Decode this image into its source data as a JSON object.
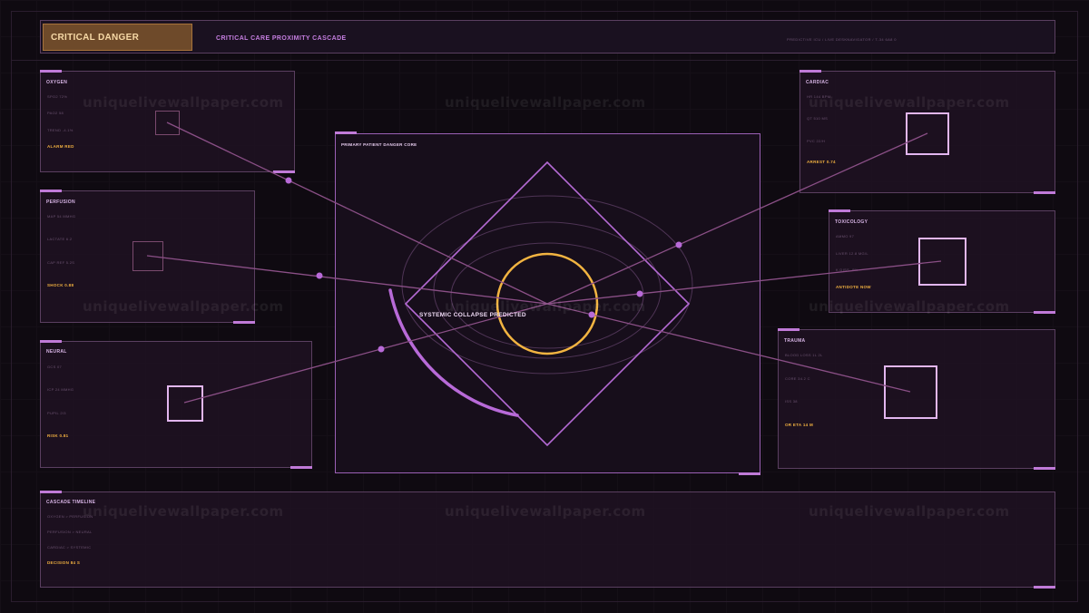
{
  "header": {
    "alert": "CRITICAL DANGER",
    "title": "CRITICAL CARE PROXIMITY CASCADE",
    "meta": "PREDICTIVE ICU  /  LIVE DESKNAVIGATOR  /  T-34 6A8 0"
  },
  "panels": {
    "oxygen": {
      "title": "OXYGEN",
      "lines": [
        "SPO2 72%",
        "PAO2 58",
        "TREND -4.1%"
      ],
      "alarm": "ALARM RED"
    },
    "perfusion": {
      "title": "PERFUSION",
      "lines": [
        "MAP 54 MMHG",
        "LACTATE 6.2",
        "CAP REF 5.2S"
      ],
      "alarm": "SHOCK 0.88"
    },
    "neural": {
      "title": "NEURAL",
      "lines": [
        "GCS 07",
        "ICP 24 MMHG",
        "PUPIL 2/3"
      ],
      "alarm": "RISK 0.81"
    },
    "cardiac": {
      "title": "CARDIAC",
      "lines": [
        "HR 144 BPM",
        "QT 510 MS",
        "PVC 22/H"
      ],
      "alarm": "ARREST 0.74"
    },
    "toxicology": {
      "title": "TOXICOLOGY",
      "lines": [
        "AMMO 97",
        "LIVER 12.8 MG/L",
        "K DISS  -0%"
      ],
      "alarm": "ANTIDOTE NOW"
    },
    "trauma": {
      "title": "TRAUMA",
      "lines": [
        "BLOOD LOSS 1L 2L",
        "CORE 34.2 C",
        "ISS 38"
      ],
      "alarm": "OR ETA 14 M"
    },
    "timeline": {
      "title": "CASCADE TIMELINE",
      "lines": [
        "OXYGEN > PERFUSION",
        "PERFUSION > NEURAL",
        "CARDIAC > SYSTEMIC"
      ],
      "alarm": "DECISION 84 S"
    }
  },
  "center": {
    "title": "PRIMARY PATIENT DANGER CORE",
    "collapse": "SYSTEMIC COLLAPSE PREDICTED"
  },
  "watermark": "uniquelivewallpaper.com",
  "colors": {
    "accent": "#c07ad8",
    "alert": "#f0b040",
    "alert_badge": "#6e4a2a",
    "core_ring": "#f2b441",
    "link": "#8a4f86"
  }
}
